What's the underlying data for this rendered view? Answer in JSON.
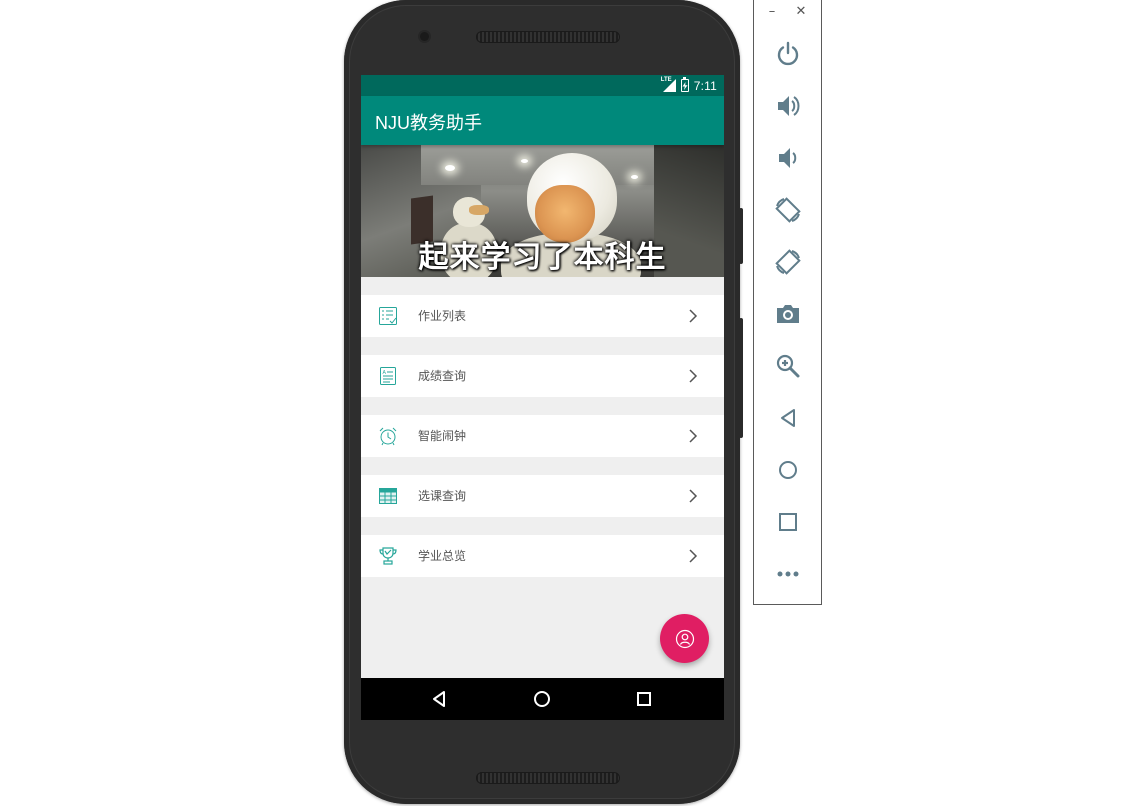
{
  "status_bar": {
    "network": "LTE",
    "time": "7:11"
  },
  "app_bar": {
    "title": "NJU教务助手"
  },
  "banner": {
    "caption": "起来学习了本科生"
  },
  "menu": {
    "items": [
      {
        "label": "作业列表",
        "icon": "checklist-icon"
      },
      {
        "label": "成绩查询",
        "icon": "grade-report-icon"
      },
      {
        "label": "智能闹钟",
        "icon": "alarm-clock-icon"
      },
      {
        "label": "选课查询",
        "icon": "table-grid-icon"
      },
      {
        "label": "学业总览",
        "icon": "trophy-icon"
      }
    ]
  },
  "fab": {
    "icon": "user-profile-icon"
  },
  "nav_bar": {
    "buttons": [
      "back-icon",
      "home-icon",
      "recent-apps-icon"
    ]
  },
  "emulator_toolbar": {
    "window_controls": [
      "minimize-icon",
      "close-icon"
    ],
    "minimize_glyph": "–",
    "close_glyph": "✕",
    "tools": [
      "power-icon",
      "volume-up-icon",
      "volume-down-icon",
      "rotate-left-icon",
      "rotate-right-icon",
      "camera-icon",
      "zoom-icon",
      "back-icon",
      "home-icon",
      "overview-icon",
      "more-icon"
    ]
  },
  "colors": {
    "status_bar": "#00695c",
    "app_bar": "#00897b",
    "accent_icon": "#26a69a",
    "fab": "#e01e63",
    "background": "#efefef",
    "toolbar_icon": "#607d8b"
  }
}
